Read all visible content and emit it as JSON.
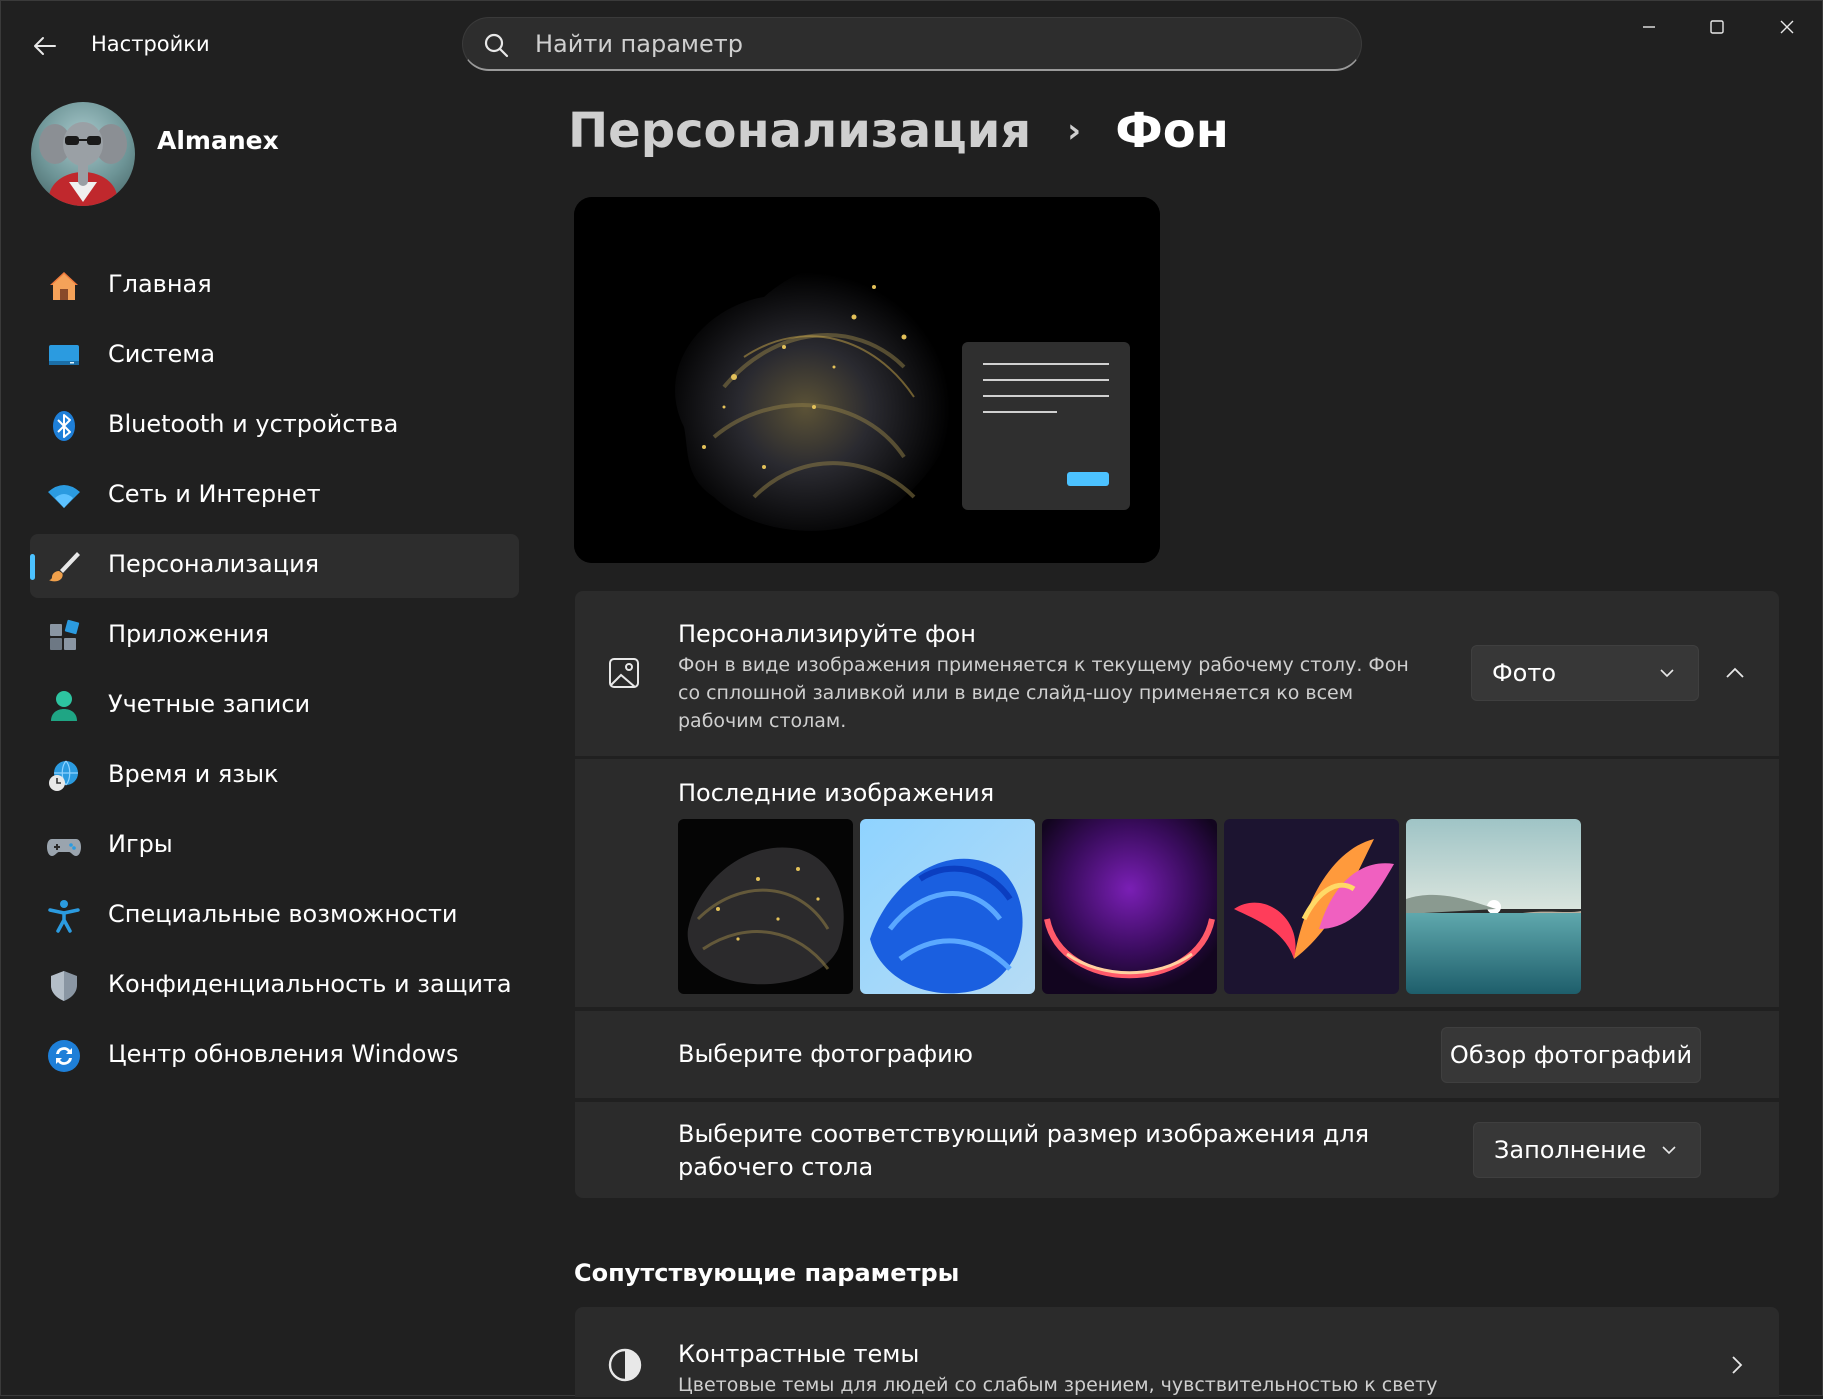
{
  "titlebar": {
    "app_title": "Настройки",
    "search_placeholder": "Найти параметр"
  },
  "user": {
    "name": "Almanex"
  },
  "sidebar": {
    "items": [
      {
        "label": "Главная",
        "icon": "home-icon"
      },
      {
        "label": "Система",
        "icon": "monitor-icon"
      },
      {
        "label": "Bluetooth и устройства",
        "icon": "bluetooth-icon"
      },
      {
        "label": "Сеть и Интернет",
        "icon": "wifi-icon"
      },
      {
        "label": "Персонализация",
        "icon": "brush-icon",
        "active": true
      },
      {
        "label": "Приложения",
        "icon": "apps-icon"
      },
      {
        "label": "Учетные записи",
        "icon": "person-icon"
      },
      {
        "label": "Время и язык",
        "icon": "globe-clock-icon"
      },
      {
        "label": "Игры",
        "icon": "gamepad-icon"
      },
      {
        "label": "Специальные возможности",
        "icon": "accessibility-icon"
      },
      {
        "label": "Конфиденциальность и защита",
        "icon": "shield-icon"
      },
      {
        "label": "Центр обновления Windows",
        "icon": "update-icon"
      }
    ]
  },
  "breadcrumb": {
    "parent": "Персонализация",
    "separator": "›",
    "current": "Фон"
  },
  "background_card": {
    "title": "Персонализируйте фон",
    "description": "Фон в виде изображения применяется к текущему рабочему столу. Фон со сплошной заливкой или в виде слайд-шоу применяется ко всем рабочим столам.",
    "dropdown_value": "Фото"
  },
  "recent": {
    "title": "Последние изображения",
    "thumbnails": [
      "gold-swirl",
      "blue-bloom",
      "purple-glow",
      "colorful-flow",
      "lake-landscape"
    ]
  },
  "choose_photo": {
    "label": "Выберите фотографию",
    "button": "Обзор фотографий"
  },
  "fit": {
    "label": "Выберите соответствующий размер изображения для рабочего стола",
    "value": "Заполнение"
  },
  "related": {
    "title": "Сопутствующие параметры",
    "contrast_title": "Контрастные темы",
    "contrast_desc": "Цветовые темы для людей со слабым зрением, чувствительностью к свету"
  },
  "colors": {
    "accent": "#4cc2ff",
    "background": "#202020",
    "card": "#2b2b2b"
  }
}
